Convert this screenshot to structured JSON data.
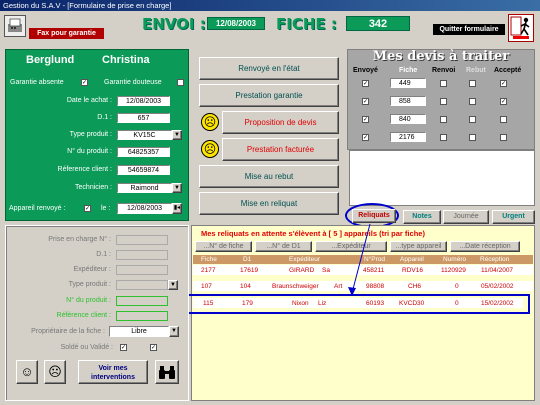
{
  "window": {
    "title": "Gestion du S.A.V - [Formulaire de prise en charge]"
  },
  "header": {
    "fax_label": "Fax pour garantie",
    "envoi_label": "ENVOI :",
    "envoi_date": "12/08/2003",
    "fiche_label": "FICHE :",
    "fiche_number": "342",
    "quit_label": "Quitter formulaire"
  },
  "client": {
    "first_name": "Berglund",
    "last_name": "Christina",
    "garantie_absente_label": "Garantie absente",
    "garantie_absente_checked": "✓",
    "garantie_douteuse_label": "Garantie douteuse",
    "garantie_douteuse_checked": "",
    "date_achat_label": "Date le achat :",
    "date_achat": "12/08/2003",
    "d1_label": "D.1 :",
    "d1": "657",
    "type_produit_label": "Type produit :",
    "type_produit": "KV15C",
    "num_produit_label": "N° du produit :",
    "num_produit": "64825357",
    "ref_client_label": "Réference client :",
    "ref_client": "54659874",
    "technicien_label": "Technicien :",
    "technicien": "Raimond",
    "appareil_renvoye_label": "Appareil renvoyé :",
    "appareil_renvoye_checked": "✓",
    "le_label": "le :",
    "le_date": "12/08/2003"
  },
  "actions": {
    "renvoye": "Renvoyé en l'état",
    "prestation_garantie": "Prestation garantie",
    "proposition_devis": "Proposition de devis",
    "prestation_facturee": "Prestation facturée",
    "mise_au_rebut": "Mise au rebut",
    "mise_en_reliquat": "Mise en reliquat"
  },
  "devis": {
    "title": "Mes devis à traiter",
    "headers": [
      "Envoyé",
      "Fiche",
      "Renvoi",
      "Rebut",
      "Accepté"
    ],
    "rows": [
      {
        "envoye": "✓",
        "fiche": "449",
        "renvoi": "",
        "rebut": "",
        "accepte": "✓"
      },
      {
        "envoye": "✓",
        "fiche": "858",
        "renvoi": "",
        "rebut": "",
        "accepte": "✓"
      },
      {
        "envoye": "✓",
        "fiche": "840",
        "renvoi": "",
        "rebut": "",
        "accepte": ""
      },
      {
        "envoye": "✓",
        "fiche": "2176",
        "renvoi": "",
        "rebut": "",
        "accepte": ""
      }
    ]
  },
  "tabs": [
    "Reliquats",
    "Notes",
    "Journée",
    "Urgent"
  ],
  "reliquats": {
    "title": "Mes reliquats en attente  s'élèvent à [ 5 ] appareils (tri par fiche)",
    "sort_buttons": [
      "...N° de fiche",
      "...N° de D1",
      "...Expéditeur",
      "...type appareil",
      "...Date réception"
    ],
    "headers": [
      "Fiche",
      "D1",
      "Expéditeur",
      "",
      "N°Prod",
      "Appareil",
      "Numéro",
      "Réception"
    ],
    "rows": [
      [
        "2177",
        "17619",
        "GIRARD",
        "Sa",
        "458211",
        "RDV16",
        "1120929",
        "11/04/2007"
      ],
      [
        "107",
        "104",
        "Braunschweiger",
        "Art",
        "98808",
        "CH6",
        "0",
        "05/02/2002"
      ],
      [
        "115",
        "179",
        "Nixon",
        "Liz",
        "60193",
        "KVCD30",
        "0",
        "15/02/2002"
      ]
    ]
  },
  "lower": {
    "prise_en_charge": "Prise en charge N° :",
    "d1": "D.1 :",
    "expediteur": "Expéditeur :",
    "type_produit": "Type produit :",
    "num_produit": "N° du produit :",
    "ref_client": "Référence client :",
    "proprietaire": "Propriétaire de la fiche :",
    "proprietaire_value": "Libre",
    "solde": "Soldé ou Validé :",
    "voir_mes_interventions": "Voir mes interventions"
  },
  "colors": {
    "accent_green": "#0b9a58",
    "action_red": "#e00000",
    "highlight_blue": "#0000cc",
    "window_gray": "#d4d0c8"
  }
}
